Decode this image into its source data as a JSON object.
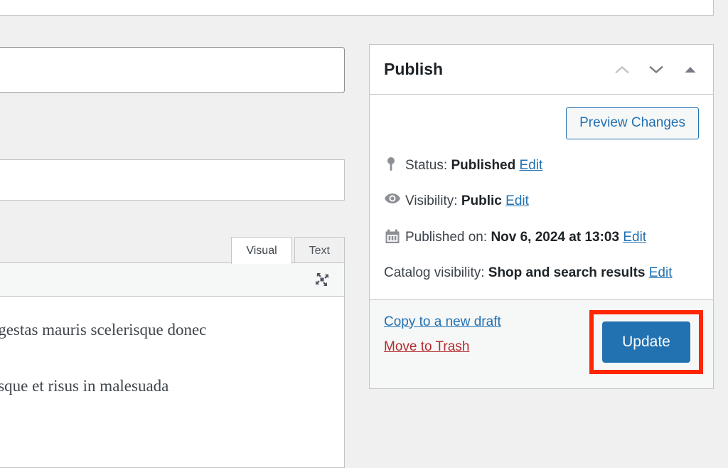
{
  "editor": {
    "title_value": "",
    "title_placeholder": "",
    "tabs": [
      {
        "label": "Visual",
        "active": true
      },
      {
        "label": "Text",
        "active": false
      }
    ],
    "expand_icon": "fullscreen-expand-icon",
    "content_paragraphs": [
      "egestas mauris scelerisque donec",
      "esque et risus in malesuada"
    ]
  },
  "publish": {
    "title": "Publish",
    "controls": [
      {
        "name": "move-up",
        "icon": "chevron-up-icon"
      },
      {
        "name": "move-down",
        "icon": "chevron-down-icon"
      },
      {
        "name": "toggle-panel",
        "icon": "triangle-up-icon"
      }
    ],
    "preview_button": "Preview Changes",
    "status": {
      "icon": "pin-icon",
      "label": "Status:",
      "value": "Published",
      "edit": "Edit"
    },
    "visibility": {
      "icon": "eye-icon",
      "label": "Visibility:",
      "value": "Public",
      "edit": "Edit"
    },
    "published_on": {
      "icon": "calendar-icon",
      "label": "Published on:",
      "value": "Nov 6, 2024 at 13:03",
      "edit": "Edit"
    },
    "catalog_visibility": {
      "label": "Catalog visibility:",
      "value": "Shop and search results",
      "edit": "Edit"
    },
    "footer": {
      "copy_draft": "Copy to a new draft",
      "move_to_trash": "Move to Trash",
      "update_button": "Update"
    }
  },
  "colors": {
    "primary_blue": "#2271b1",
    "link_blue": "#2271b1",
    "danger_red": "#b32d2e",
    "highlight_red": "#ff2600",
    "page_bg": "#f0f0f1",
    "border": "#c3c4c7"
  }
}
